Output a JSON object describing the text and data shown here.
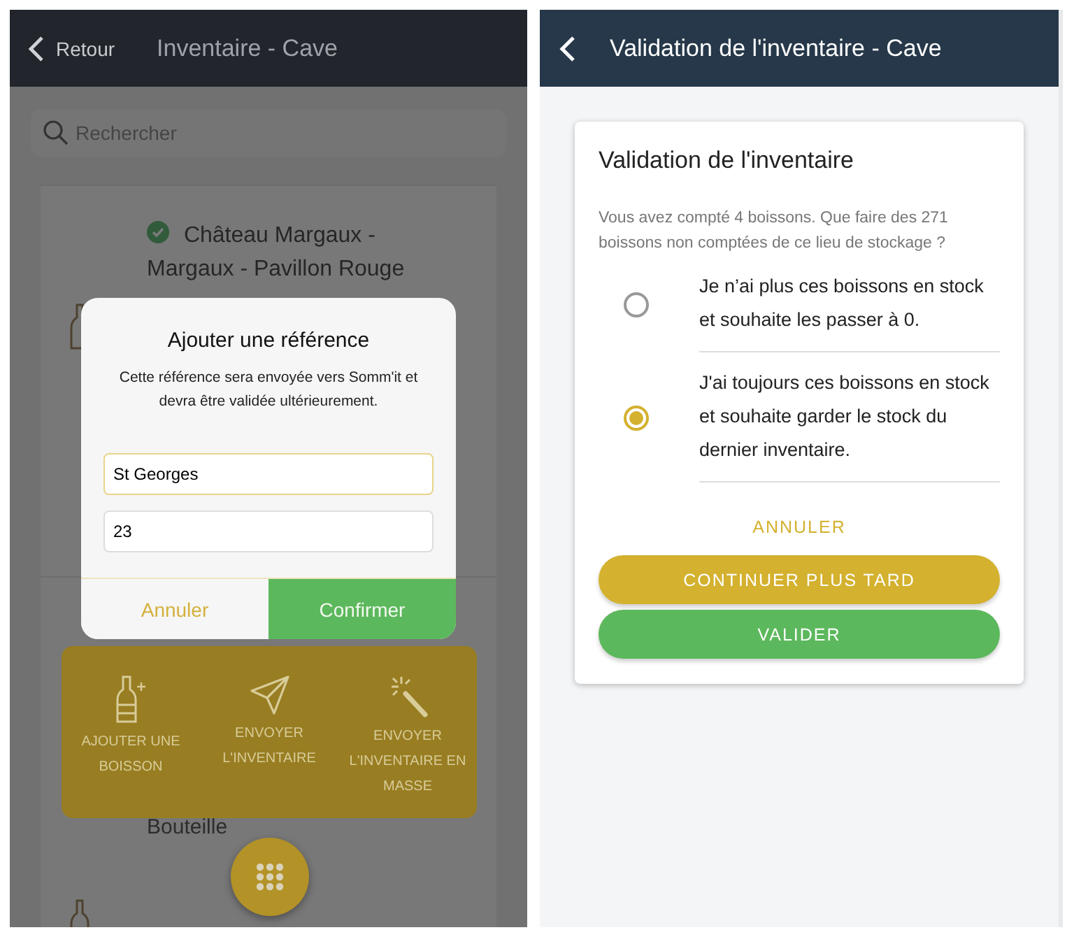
{
  "left_screen": {
    "header": {
      "back": "Retour",
      "title": "Inventaire - Cave"
    },
    "search": {
      "placeholder": "Rechercher"
    },
    "list": [
      {
        "title": "Château Margaux - Margaux - Pavillon Rouge",
        "validated": true
      },
      {
        "subtitle": "Bouteille"
      }
    ],
    "dialog": {
      "title": "Ajouter une référence",
      "message": "Cette référence sera envoyée vers Somm'it et devra être validée ultérieurement.",
      "fields": [
        {
          "value": "St Georges",
          "focused": true
        },
        {
          "value": "23",
          "focused": false
        }
      ],
      "cancel": "Annuler",
      "confirm": "Confirmer"
    },
    "actions": [
      {
        "label": "AJOUTER UNE BOISSON",
        "kind": "add"
      },
      {
        "label": "ENVOYER L'INVENTAIRE",
        "kind": "send"
      },
      {
        "label": "ENVOYER L'INVENTAIRE EN MASSE",
        "kind": "bulk"
      }
    ]
  },
  "right_screen": {
    "header": {
      "title": "Validation de l'inventaire - Cave"
    },
    "card": {
      "title": "Validation de l'inventaire",
      "message": "Vous avez compté 4 boissons. Que faire des 271 boissons non comptées de ce lieu de stockage ?",
      "options": [
        {
          "label": "Je n’ai plus ces boissons en stock et souhaite les passer à 0.",
          "selected": false
        },
        {
          "label": "J'ai toujours ces boissons en stock et souhaite garder le stock du dernier inventaire.",
          "selected": true
        }
      ],
      "cancel": "ANNULER",
      "buttons": [
        {
          "label": "CONTINUER PLUS TARD",
          "kind": "later"
        },
        {
          "label": "VALIDER",
          "kind": "validate"
        }
      ]
    }
  }
}
